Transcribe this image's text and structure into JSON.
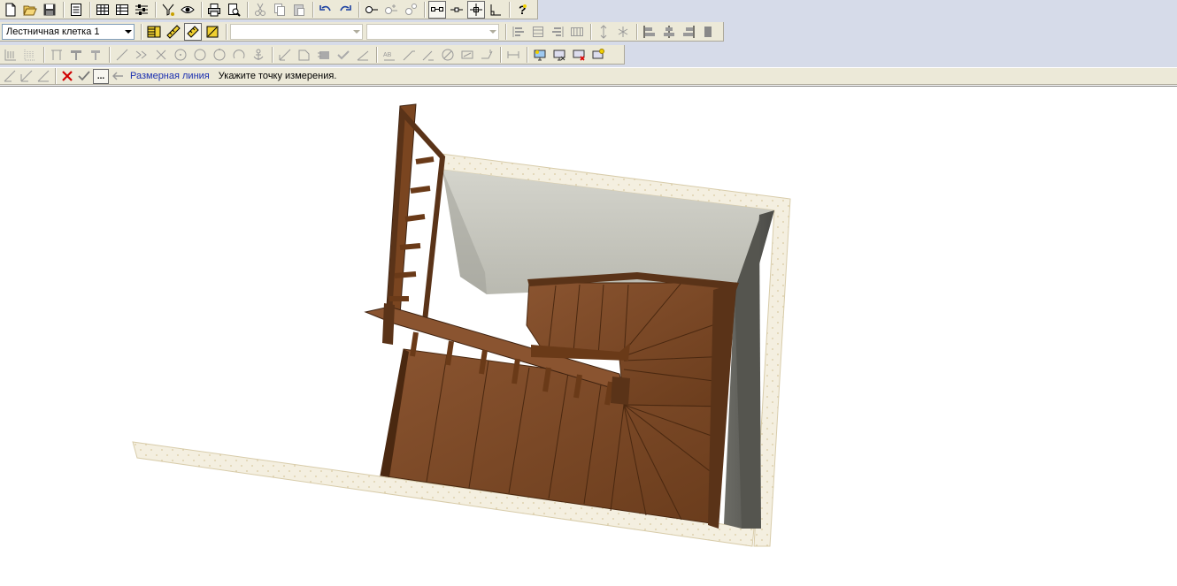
{
  "toolbar_top": {
    "buttons": [
      "new-file-icon",
      "open-folder-icon",
      "save-icon",
      "properties-icon",
      "table-icon",
      "table-edit-icon",
      "settings-sliders-icon",
      "filter-icon",
      "view-eye-icon",
      "print-icon",
      "print-preview-icon",
      "cut-icon",
      "copy-icon",
      "paste-icon",
      "undo-icon",
      "redo-icon",
      "node-icon",
      "node-add-icon",
      "node-tree-icon",
      "snap-line-icon",
      "snap-point-icon",
      "snap-cross-icon",
      "angle-icon",
      "help-icon"
    ]
  },
  "toolbar_second": {
    "stair_combo_value": "Лестничная клетка 1",
    "combo2_value": "",
    "combo3_value": ""
  },
  "toolbar_third": {},
  "command_bar": {
    "mode_label": "Размерная линия",
    "prompt": "Укажите точку измерения.",
    "dots_label": "..."
  },
  "colors": {
    "ui_face": "#ece9d8",
    "ui_backdrop": "#d6dbe9",
    "wood": "#7a4a28",
    "wood_dark": "#5a3318",
    "wall_light": "#c9c9c1",
    "floor_pattern": "#f4efe0",
    "mode_label": "#1a2fb0"
  }
}
